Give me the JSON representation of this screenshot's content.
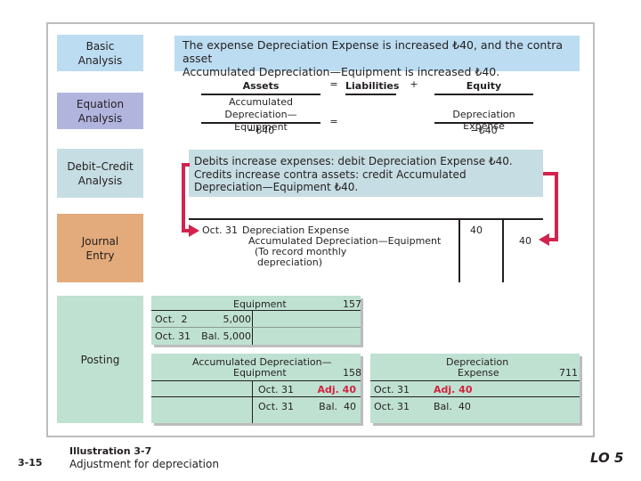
{
  "illustration": {
    "page_number": "3-15",
    "title": "Illustration 3-7",
    "subtitle": "Adjustment for depreciation",
    "learning_objective": "LO 5"
  },
  "colors": {
    "basic": "#bcdcf2",
    "equation": "#b1b5de",
    "debit_credit": "#c6dde3",
    "journal": "#e3aa7b",
    "posting": "#bfe1d2",
    "arrow": "#d2234f",
    "adjustment_text": "#d2233f"
  },
  "rows": {
    "basic_label_1": "Basic",
    "basic_label_2": "Analysis",
    "equation_label_1": "Equation",
    "equation_label_2": "Analysis",
    "debit_credit_label_1": "Debit–Credit",
    "debit_credit_label_2": "Analysis",
    "journal_label_1": "Journal",
    "journal_label_2": "Entry",
    "posting_label": "Posting"
  },
  "basic_analysis": {
    "line1": "The expense Depreciation Expense is increased ₺40, and the contra asset",
    "line2": "Accumulated Depreciation—Equipment is increased ₺40."
  },
  "equation": {
    "assets_header": "Assets",
    "eq_sign": "=",
    "liabilities_header": "Liabilities",
    "plus_sign": "+",
    "equity_header": "Equity",
    "asset_account_1": "Accumulated",
    "asset_account_2": "Depreciation—Equipment",
    "asset_amount": "−₺40",
    "eq_sign_2": "=",
    "equity_account": "Depreciation Expense",
    "equity_amount": "−₺40"
  },
  "debit_credit": {
    "line1": "Debits increase expenses: debit Depreciation Expense ₺40.",
    "line2": "Credits increase contra assets: credit Accumulated",
    "line3": "Depreciation—Equipment ₺40."
  },
  "journal_entry": {
    "date": "Oct. 31",
    "debit_account": "Depreciation Expense",
    "credit_account": "Accumulated Depreciation—Equipment",
    "explanation_1": "(To record monthly",
    "explanation_2": "depreciation)",
    "debit_amount": "40",
    "credit_amount": "40"
  },
  "posting": {
    "equipment": {
      "name": "Equipment",
      "number": "157",
      "rows": [
        {
          "date": "Oct.  2",
          "amount": "5,000"
        },
        {
          "date": "Oct. 31",
          "amount": "Bal. 5,000"
        }
      ]
    },
    "accum_dep": {
      "name_1": "Accumulated Depreciation—",
      "name_2": "Equipment",
      "number": "158",
      "rows": [
        {
          "date": "Oct. 31",
          "amount": "Adj. 40"
        },
        {
          "date": "Oct. 31",
          "amount": "Bal.  40"
        }
      ]
    },
    "dep_expense": {
      "name_1": "Depreciation",
      "name_2": "Expense",
      "number": "711",
      "rows": [
        {
          "date": "Oct. 31",
          "amount": "Adj. 40"
        },
        {
          "date": "Oct. 31",
          "amount": "Bal.  40"
        }
      ]
    }
  }
}
